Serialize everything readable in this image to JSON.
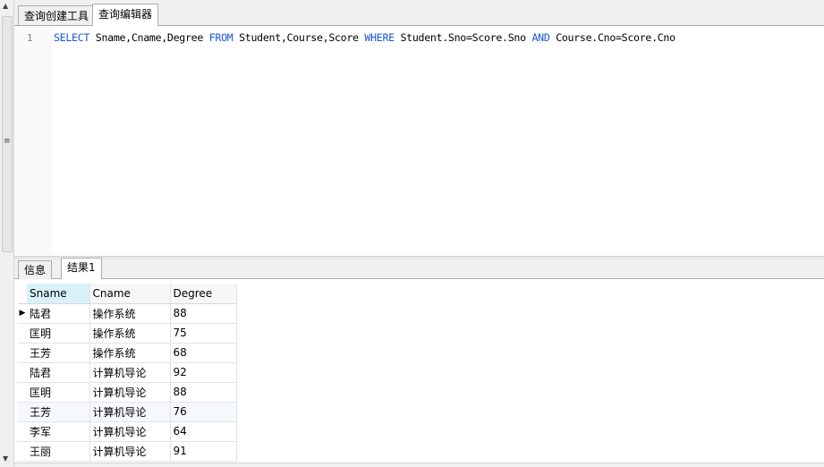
{
  "tabs": [
    {
      "label": "查询创建工具",
      "active": false
    },
    {
      "label": "查询编辑器",
      "active": true
    }
  ],
  "editor": {
    "line_number": "1",
    "tokens": [
      {
        "text": "SELECT",
        "keyword": true
      },
      {
        "text": " Sname,Cname,Degree ",
        "keyword": false
      },
      {
        "text": "FROM",
        "keyword": true
      },
      {
        "text": " Student,Course,Score ",
        "keyword": false
      },
      {
        "text": "WHERE",
        "keyword": true
      },
      {
        "text": " Student.Sno=Score.Sno ",
        "keyword": false
      },
      {
        "text": "AND",
        "keyword": true
      },
      {
        "text": " Course.Cno=Score.Cno",
        "keyword": false
      }
    ]
  },
  "result_tabs": [
    {
      "label": "信息",
      "active": false
    },
    {
      "label": "结果1",
      "active": true
    }
  ],
  "grid": {
    "columns": [
      "Sname",
      "Cname",
      "Degree"
    ],
    "rows": [
      [
        "陆君",
        "操作系统",
        "88"
      ],
      [
        "匡明",
        "操作系统",
        "75"
      ],
      [
        "王芳",
        "操作系统",
        "68"
      ],
      [
        "陆君",
        "计算机导论",
        "92"
      ],
      [
        "匡明",
        "计算机导论",
        "88"
      ],
      [
        "王芳",
        "计算机导论",
        "76"
      ],
      [
        "李军",
        "计算机导论",
        "64"
      ],
      [
        "王丽",
        "计算机导论",
        "91"
      ]
    ],
    "current_row_index": 0
  },
  "colors": {
    "keyword": "#1a56d6",
    "sorted_header": "#d9f1fb"
  },
  "icons": {
    "row_indicator": "▶",
    "scroll_up": "▲",
    "scroll_down": "▼",
    "splitter_grip": "≡"
  }
}
